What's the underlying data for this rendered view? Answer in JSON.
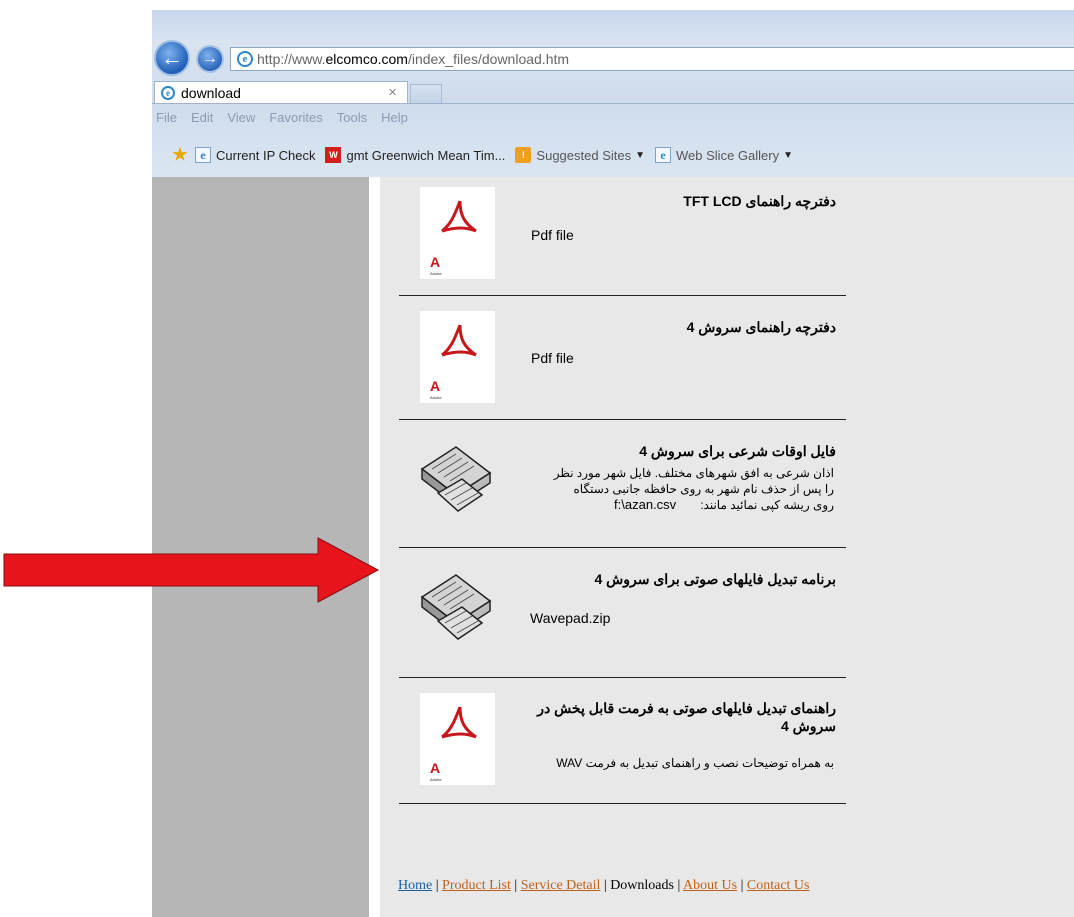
{
  "browser": {
    "url_prefix": "http://www.",
    "url_domain": "elcomco.com",
    "url_path": "/index_files/download.htm",
    "tab_title": "download",
    "tab_close": "×",
    "menu": [
      "File",
      "Edit",
      "View",
      "Favorites",
      "Tools",
      "Help"
    ],
    "favorites": [
      {
        "label": "Current IP Check",
        "icon": "ie-page-icon"
      },
      {
        "label": "gmt Greenwich Mean Tim...",
        "icon": "gmt-icon"
      },
      {
        "label": "Suggested Sites",
        "icon": "suggested-sites-icon",
        "dropdown": true
      },
      {
        "label": "Web Slice Gallery",
        "icon": "ie-page-icon",
        "dropdown": true
      }
    ]
  },
  "downloads": [
    {
      "title": "دفترچه راهنمای   TFT LCD",
      "type_label": "Pdf file",
      "thumb": "pdf-icon"
    },
    {
      "title": "دفترچه راهنمای سروش 4",
      "type_label": "Pdf file",
      "thumb": "pdf-icon"
    },
    {
      "title": "فایل اوقات شرعی برای سروش 4",
      "description_lines": [
        "اذان شرعی به افق شهرهای مختلف. فایل شهر مورد نظر",
        "را پس از حذف نام شهر به روی حافظه جانبی دستگاه",
        "روی ریشه کپی نمائید مانند:"
      ],
      "file": "f:\\azan.csv",
      "thumb": "device-icon"
    },
    {
      "title": "برنامه تبدیل فایلهای صوتی برای سروش 4",
      "type_label": "Wavepad.zip",
      "thumb": "device-icon"
    },
    {
      "title": "راهنمای تبدیل فایلهای صوتی به فرمت قابل پخش در سروش 4",
      "description": "به همراه توضیحات نصب و راهنمای تبدیل به فرمت WAV",
      "thumb": "pdf-icon"
    }
  ],
  "footer": {
    "links": [
      "Home",
      "Product List",
      "Service Detail",
      "Downloads",
      "About Us",
      "Contact Us"
    ],
    "current": "Downloads",
    "separator": "|"
  },
  "colors": {
    "arrow": "#e8141c",
    "link": "#c06018",
    "home_link": "#1a5fa0",
    "sidebar": "#b6b6b6"
  }
}
